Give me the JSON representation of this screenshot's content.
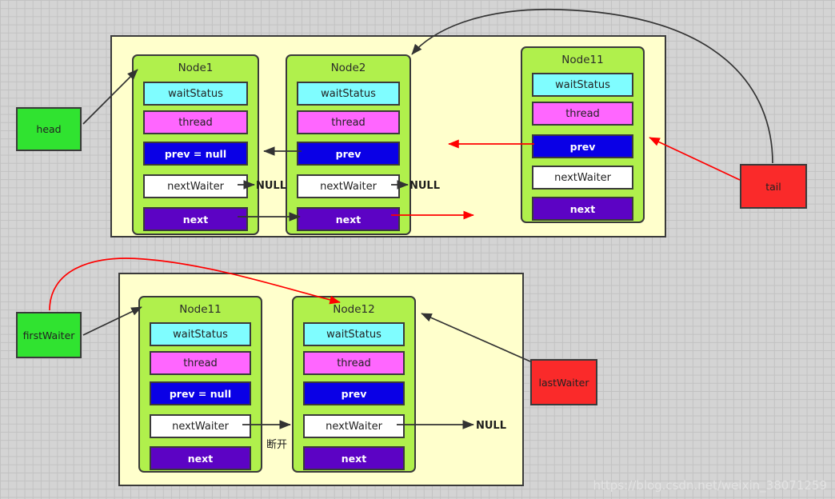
{
  "background": {
    "color": "#d4d4d4",
    "grid_line_color": "#c2c2c2"
  },
  "watermark": "https://blog.csdn.net/weixin_38071259",
  "colors": {
    "panel_fill": "#ffffcc",
    "node_fill": "#b0f04c",
    "waitstatus_fill": "#7ffdff",
    "thread_fill": "#ff66ff",
    "prev_fill": "#0a00e6",
    "nextwaiter_fill": "#ffffff",
    "next_fill": "#5c03c4",
    "pointer_green": "#30e330",
    "pointer_red": "#fa2a2a",
    "arrow_black": "#333333",
    "arrow_red": "#ff0000",
    "border": "#3a3a3a"
  },
  "top_diagram": {
    "nodes": [
      {
        "title": "Node1",
        "fields": {
          "waitStatus": "waitStatus",
          "thread": "thread",
          "prev": "prev = null",
          "nextWaiter": "nextWaiter",
          "next": "next"
        }
      },
      {
        "title": "Node2",
        "fields": {
          "waitStatus": "waitStatus",
          "thread": "thread",
          "prev": "prev",
          "nextWaiter": "nextWaiter",
          "next": "next"
        }
      },
      {
        "title": "Node11",
        "fields": {
          "waitStatus": "waitStatus",
          "thread": "thread",
          "prev": "prev",
          "nextWaiter": "nextWaiter",
          "next": "next"
        }
      }
    ],
    "null_labels": [
      "NULL",
      "NULL"
    ],
    "pointers": [
      {
        "label": "head",
        "style": "green"
      },
      {
        "label": "tail",
        "style": "red"
      }
    ]
  },
  "bottom_diagram": {
    "nodes": [
      {
        "title": "Node11",
        "fields": {
          "waitStatus": "waitStatus",
          "thread": "thread",
          "prev": "prev = null",
          "nextWaiter": "nextWaiter",
          "next": "next"
        }
      },
      {
        "title": "Node12",
        "fields": {
          "waitStatus": "waitStatus",
          "thread": "thread",
          "prev": "prev",
          "nextWaiter": "nextWaiter",
          "next": "next"
        }
      }
    ],
    "null_labels": [
      "NULL"
    ],
    "annotation": "断开",
    "pointers": [
      {
        "label": "firstWaiter",
        "style": "green"
      },
      {
        "label": "lastWaiter",
        "style": "red"
      }
    ]
  }
}
